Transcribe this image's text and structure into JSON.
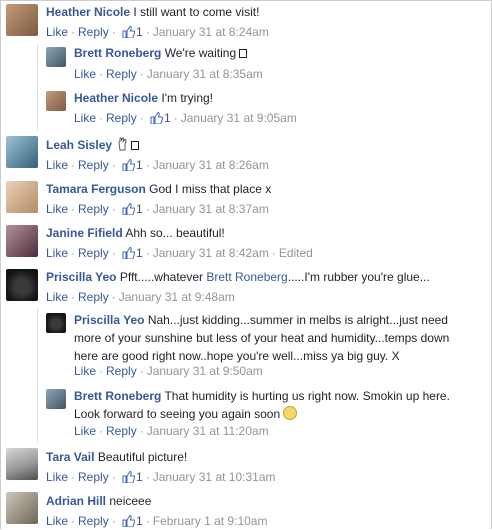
{
  "actions": {
    "like": "Like",
    "reply": "Reply"
  },
  "comments": [
    {
      "name": "Heather Nicole",
      "text": "I still want to come visit!",
      "likes": "1",
      "time": "January 31 at 8:24am"
    },
    {
      "name": "Brett Roneberg",
      "text": "We're waiting",
      "time": "January 31 at 8:35am"
    },
    {
      "name": "Heather Nicole",
      "text": "I'm trying!",
      "likes": "1",
      "time": "January 31 at 9:05am"
    },
    {
      "name": "Leah Sisley",
      "text": "",
      "likes": "1",
      "time": "January 31 at 8:26am"
    },
    {
      "name": "Tamara Ferguson",
      "text": "God I miss that place x",
      "likes": "1",
      "time": "January 31 at 8:37am"
    },
    {
      "name": "Janine Fifield",
      "text": "Ahh so... beautiful!",
      "likes": "1",
      "time": "January 31 at 8:42am",
      "edited": "Edited"
    },
    {
      "name": "Priscilla Yeo",
      "text_a": "Pfft.....whatever",
      "mention": "Brett Roneberg",
      "text_b": ".....I'm rubber you're glue...",
      "time": "January 31 at 9:48am"
    },
    {
      "name": "Priscilla Yeo",
      "text": "Nah...just kidding...summer in melbs is alright...just need more of your sunshine but less of your heat and humidity...temps down here are good right now..hope you're well...miss ya big guy. X",
      "time": "January 31 at 9:50am"
    },
    {
      "name": "Brett Roneberg",
      "text": "That humidity is hurting us right now. Smokin up here. Look forward to seeing you again soon",
      "time": "January 31 at 11:20am"
    },
    {
      "name": "Tara Vail",
      "text": "Beautiful picture!",
      "likes": "1",
      "time": "January 31 at 10:31am"
    },
    {
      "name": "Adrian Hill",
      "text": "neiceee",
      "likes": "1",
      "time": "February 1 at 9:10am"
    }
  ]
}
